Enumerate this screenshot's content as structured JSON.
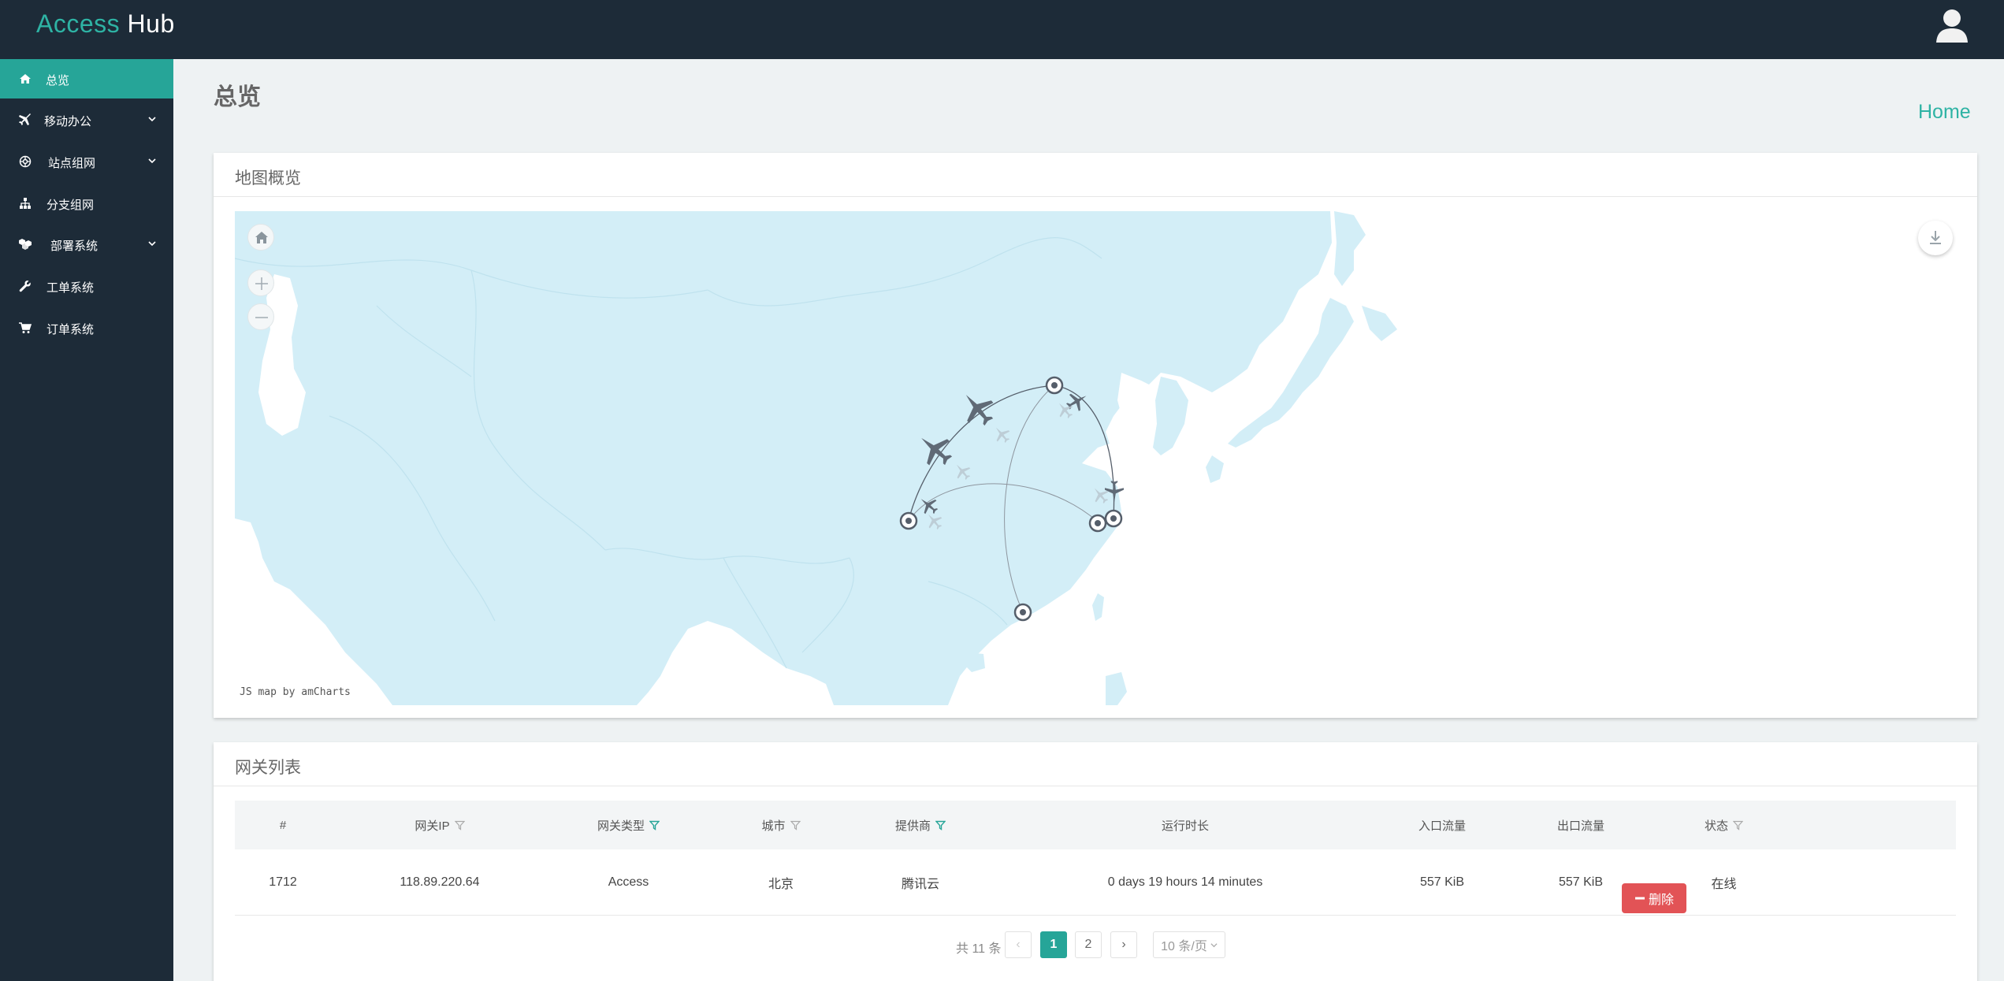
{
  "app": {
    "brand_part1": "Access",
    "brand_part2": "Hub"
  },
  "sidebar": {
    "items": [
      {
        "label": "总览",
        "icon": "home-icon",
        "active": true
      },
      {
        "label": "移动办公",
        "icon": "plane-icon",
        "has_submenu": true
      },
      {
        "label": "站点组网",
        "icon": "network-icon",
        "has_submenu": true
      },
      {
        "label": "分支组网",
        "icon": "sitemap-icon",
        "has_submenu": false
      },
      {
        "label": "部署系统",
        "icon": "cubes-icon",
        "has_submenu": true
      },
      {
        "label": "工单系统",
        "icon": "wrench-icon",
        "has_submenu": false
      },
      {
        "label": "订单系统",
        "icon": "cart-icon",
        "has_submenu": false
      }
    ]
  },
  "page": {
    "title": "总览",
    "breadcrumb": "Home"
  },
  "map_panel": {
    "title": "地图概览",
    "credit": "JS map by amCharts",
    "controls": [
      "home-icon",
      "zoom-in-icon",
      "zoom-out-icon",
      "download-icon"
    ]
  },
  "gateway_table": {
    "title": "网关列表",
    "columns": [
      {
        "label": "#",
        "filter": false
      },
      {
        "label": "网关IP",
        "filter": true,
        "filter_active": false
      },
      {
        "label": "网关类型",
        "filter": true,
        "filter_active": true
      },
      {
        "label": "城市",
        "filter": true,
        "filter_active": false
      },
      {
        "label": "提供商",
        "filter": true,
        "filter_active": true
      },
      {
        "label": "运行时长",
        "filter": false
      },
      {
        "label": "入口流量",
        "filter": false
      },
      {
        "label": "出口流量",
        "filter": false
      },
      {
        "label": "状态",
        "filter": true,
        "filter_active": false
      }
    ],
    "rows": [
      {
        "id": "1712",
        "ip": "118.89.220.64",
        "type": "Access",
        "city": "北京",
        "provider": "腾讯云",
        "uptime": "0 days 19 hours 14 minutes",
        "ingress": "557 KiB",
        "egress": "557 KiB",
        "status": "在线",
        "action": "删除"
      }
    ]
  },
  "pagination": {
    "total": "共 11 条",
    "prev": "‹",
    "pages": [
      "1",
      "2"
    ],
    "current": "1",
    "next": "›",
    "page_size": "10 条/页"
  },
  "colors": {
    "topbar": "#1d2b38",
    "accent": "#26a598",
    "danger": "#e25356",
    "map_land": "#d3eef7"
  }
}
